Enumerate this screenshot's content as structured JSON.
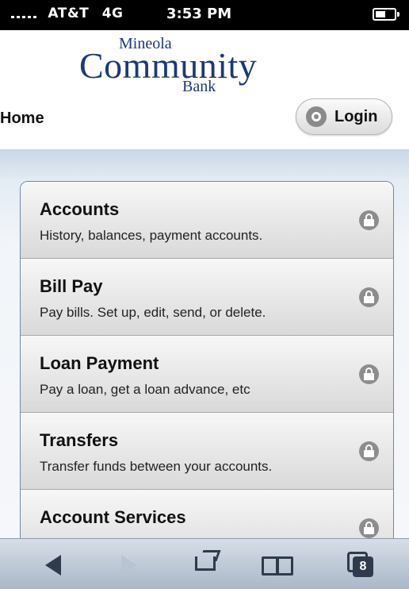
{
  "status_bar": {
    "carrier": "AT&T",
    "network": "4G",
    "time": "3:53 PM"
  },
  "logo": {
    "line1": "Mineola",
    "line2": "Community",
    "line3": "Bank"
  },
  "nav": {
    "title": "Home",
    "login_label": "Login"
  },
  "menu": {
    "items": [
      {
        "title": "Accounts",
        "description": "History, balances, payment accounts."
      },
      {
        "title": "Bill Pay",
        "description": "Pay bills. Set up, edit, send, or delete."
      },
      {
        "title": "Loan Payment",
        "description": "Pay a loan, get a loan advance, etc"
      },
      {
        "title": "Transfers",
        "description": "Transfer funds between your accounts."
      },
      {
        "title": "Account Services",
        "description": ""
      }
    ]
  },
  "toolbar": {
    "tab_count": "8"
  },
  "colors": {
    "brand": "#1c3a78",
    "toolbar": "#a9b7c8",
    "list_border": "#6f89a6"
  }
}
